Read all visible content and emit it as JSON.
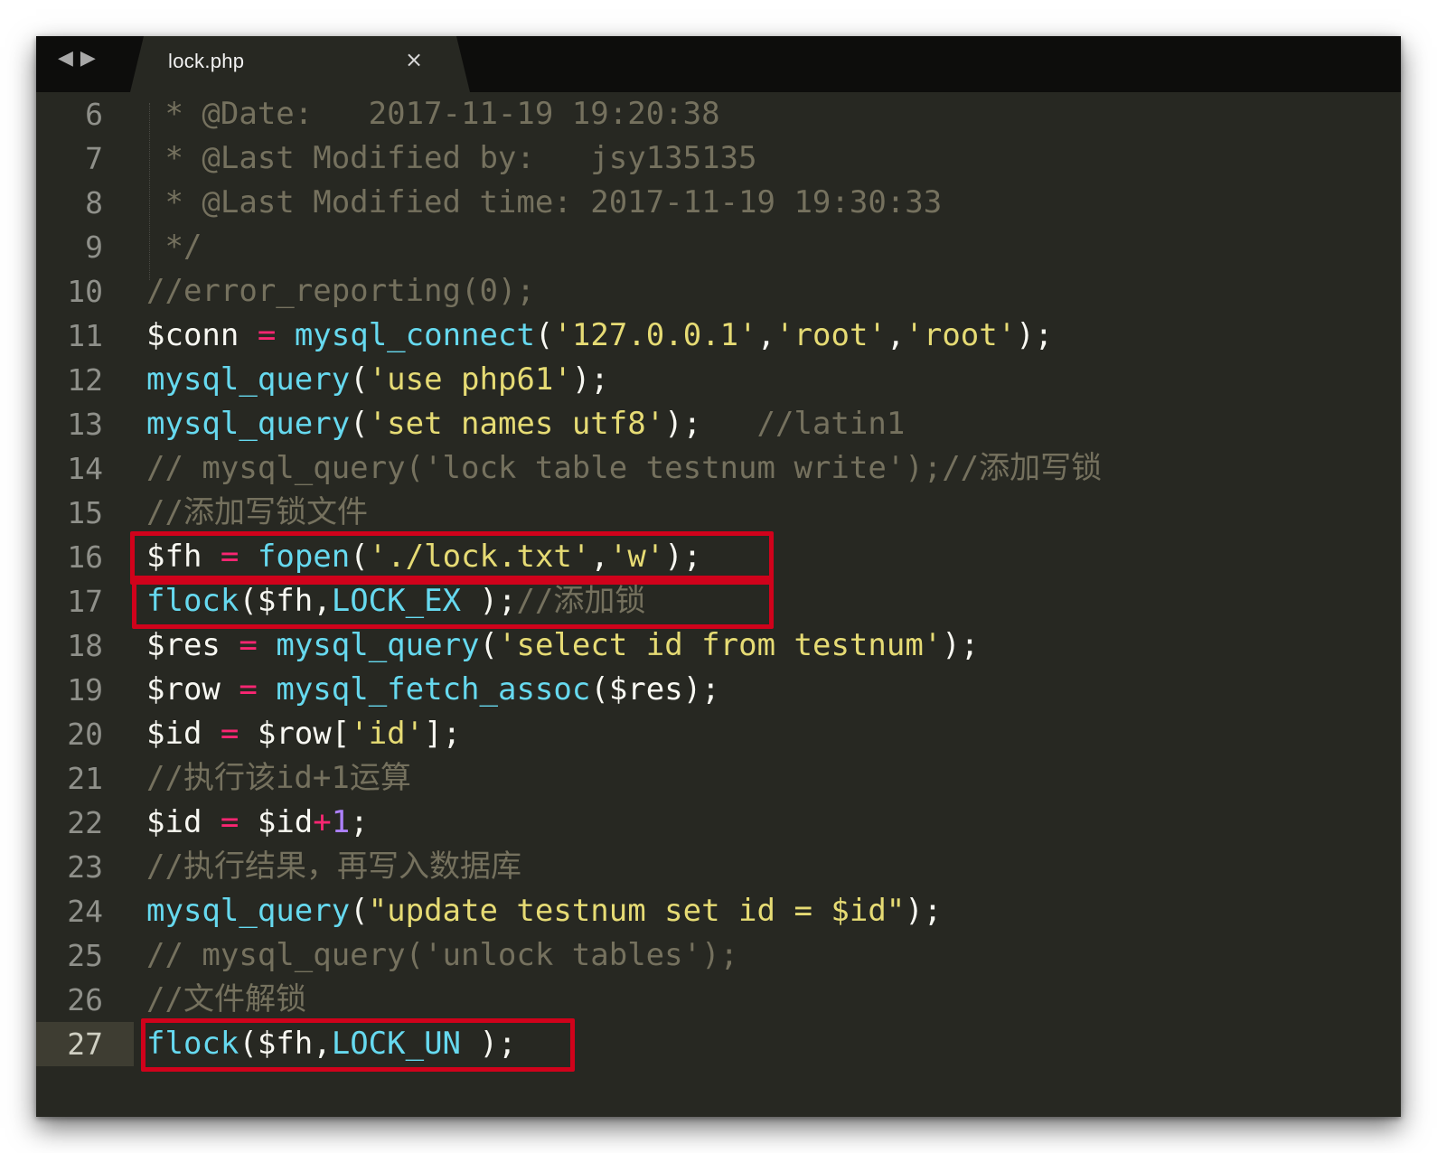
{
  "tabbar": {
    "back_glyph": "◀",
    "forward_glyph": "▶",
    "active_tab": {
      "title": "lock.php",
      "close_glyph": "×"
    }
  },
  "editor": {
    "current_line": 27,
    "highlight_color": "#d0021b",
    "highlighted_lines": [
      16,
      17,
      27
    ],
    "lines": [
      {
        "num": "6",
        "tokens": [
          {
            "t": " * @Date:   2017-11-19 19:20:38",
            "k": "c"
          }
        ]
      },
      {
        "num": "7",
        "tokens": [
          {
            "t": " * @Last Modified by:   jsy135135",
            "k": "c"
          }
        ]
      },
      {
        "num": "8",
        "tokens": [
          {
            "t": " * @Last Modified time: 2017-11-19 19:30:33",
            "k": "c"
          }
        ]
      },
      {
        "num": "9",
        "tokens": [
          {
            "t": " */",
            "k": "c"
          }
        ]
      },
      {
        "num": "10",
        "tokens": [
          {
            "t": "//error_reporting(0);",
            "k": "c"
          }
        ]
      },
      {
        "num": "11",
        "tokens": [
          {
            "t": "$conn",
            "k": "v"
          },
          {
            "t": " "
          },
          {
            "t": "=",
            "k": "o"
          },
          {
            "t": " "
          },
          {
            "t": "mysql_connect",
            "k": "f"
          },
          {
            "t": "("
          },
          {
            "t": "'127.0.0.1'",
            "k": "s"
          },
          {
            "t": ","
          },
          {
            "t": "'root'",
            "k": "s"
          },
          {
            "t": ","
          },
          {
            "t": "'root'",
            "k": "s"
          },
          {
            "t": ");"
          }
        ]
      },
      {
        "num": "12",
        "tokens": [
          {
            "t": "mysql_query",
            "k": "f"
          },
          {
            "t": "("
          },
          {
            "t": "'use php61'",
            "k": "s"
          },
          {
            "t": ");"
          }
        ]
      },
      {
        "num": "13",
        "tokens": [
          {
            "t": "mysql_query",
            "k": "f"
          },
          {
            "t": "("
          },
          {
            "t": "'set names utf8'",
            "k": "s"
          },
          {
            "t": ");   "
          },
          {
            "t": "//latin1",
            "k": "c"
          }
        ]
      },
      {
        "num": "14",
        "tokens": [
          {
            "t": "// mysql_query('lock table testnum write');//添加写锁",
            "k": "c"
          }
        ]
      },
      {
        "num": "15",
        "tokens": [
          {
            "t": "//添加写锁文件",
            "k": "c"
          }
        ]
      },
      {
        "num": "16",
        "tokens": [
          {
            "t": "$fh",
            "k": "v"
          },
          {
            "t": " "
          },
          {
            "t": "=",
            "k": "o"
          },
          {
            "t": " "
          },
          {
            "t": "fopen",
            "k": "f"
          },
          {
            "t": "("
          },
          {
            "t": "'./lock.txt'",
            "k": "s"
          },
          {
            "t": ","
          },
          {
            "t": "'w'",
            "k": "s"
          },
          {
            "t": ");"
          }
        ]
      },
      {
        "num": "17",
        "tokens": [
          {
            "t": "flock",
            "k": "f"
          },
          {
            "t": "($fh,"
          },
          {
            "t": "LOCK_EX",
            "k": "f"
          },
          {
            "t": " );"
          },
          {
            "t": "//添加锁",
            "k": "c"
          }
        ]
      },
      {
        "num": "18",
        "tokens": [
          {
            "t": "$res",
            "k": "v"
          },
          {
            "t": " "
          },
          {
            "t": "=",
            "k": "o"
          },
          {
            "t": " "
          },
          {
            "t": "mysql_query",
            "k": "f"
          },
          {
            "t": "("
          },
          {
            "t": "'select id from testnum'",
            "k": "s"
          },
          {
            "t": ");"
          }
        ]
      },
      {
        "num": "19",
        "tokens": [
          {
            "t": "$row",
            "k": "v"
          },
          {
            "t": " "
          },
          {
            "t": "=",
            "k": "o"
          },
          {
            "t": " "
          },
          {
            "t": "mysql_fetch_assoc",
            "k": "f"
          },
          {
            "t": "($res);"
          }
        ]
      },
      {
        "num": "20",
        "tokens": [
          {
            "t": "$id",
            "k": "v"
          },
          {
            "t": " "
          },
          {
            "t": "=",
            "k": "o"
          },
          {
            "t": " $row["
          },
          {
            "t": "'id'",
            "k": "s"
          },
          {
            "t": "];"
          }
        ]
      },
      {
        "num": "21",
        "tokens": [
          {
            "t": "//执行该id+1运算",
            "k": "c"
          }
        ]
      },
      {
        "num": "22",
        "tokens": [
          {
            "t": "$id",
            "k": "v"
          },
          {
            "t": " "
          },
          {
            "t": "=",
            "k": "o"
          },
          {
            "t": " $id"
          },
          {
            "t": "+",
            "k": "o"
          },
          {
            "t": "1",
            "k": "n"
          },
          {
            "t": ";"
          }
        ]
      },
      {
        "num": "23",
        "tokens": [
          {
            "t": "//执行结果，再写入数据库",
            "k": "c"
          }
        ]
      },
      {
        "num": "24",
        "tokens": [
          {
            "t": "mysql_query",
            "k": "f"
          },
          {
            "t": "("
          },
          {
            "t": "\"update testnum set id = $id\"",
            "k": "s"
          },
          {
            "t": ");"
          }
        ]
      },
      {
        "num": "25",
        "tokens": [
          {
            "t": "// mysql_query('unlock tables');",
            "k": "c"
          }
        ]
      },
      {
        "num": "26",
        "tokens": [
          {
            "t": "//文件解锁",
            "k": "c"
          }
        ]
      },
      {
        "num": "27",
        "tokens": [
          {
            "t": "flock",
            "k": "f"
          },
          {
            "t": "($fh,"
          },
          {
            "t": "LOCK_UN",
            "k": "f"
          },
          {
            "t": " );"
          }
        ]
      }
    ]
  }
}
